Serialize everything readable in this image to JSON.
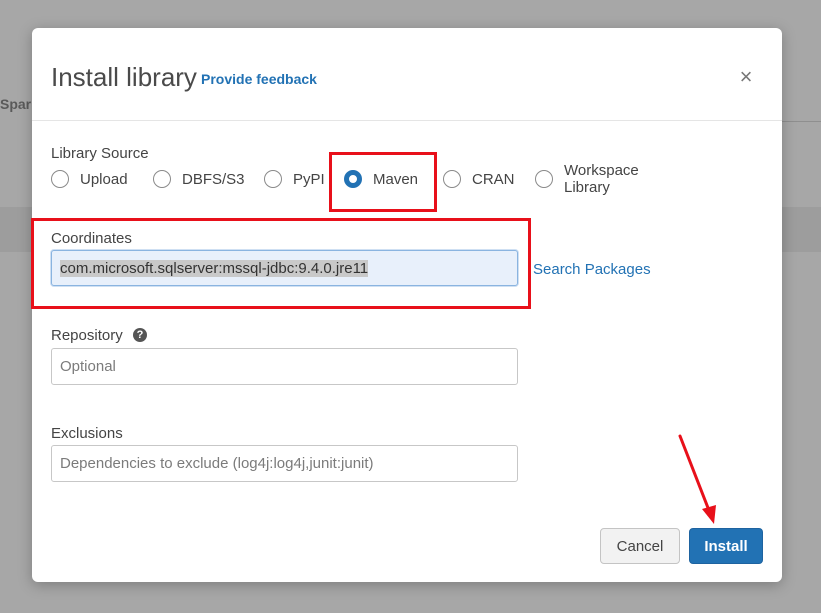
{
  "background": {
    "tab_label": "Spar"
  },
  "dialog": {
    "title": "Install library",
    "feedback_link": "Provide feedback",
    "close_icon": "close-icon"
  },
  "library_source": {
    "label": "Library Source",
    "options": [
      {
        "label": "Upload",
        "checked": false
      },
      {
        "label": "DBFS/S3",
        "checked": false
      },
      {
        "label": "PyPI",
        "checked": false
      },
      {
        "label": "Maven",
        "checked": true
      },
      {
        "label": "CRAN",
        "checked": false
      },
      {
        "label": "Workspace Library",
        "checked": false
      }
    ]
  },
  "coordinates": {
    "label": "Coordinates",
    "value": "com.microsoft.sqlserver:mssql-jdbc:9.4.0.jre11",
    "search_link": "Search Packages"
  },
  "repository": {
    "label": "Repository",
    "help_icon": "question-circle-icon",
    "placeholder": "Optional"
  },
  "exclusions": {
    "label": "Exclusions",
    "placeholder": "Dependencies to exclude (log4j:log4j,junit:junit)"
  },
  "footer": {
    "cancel_label": "Cancel",
    "install_label": "Install"
  },
  "annotation_color": "#e8101a",
  "accent_color": "#2272b4"
}
